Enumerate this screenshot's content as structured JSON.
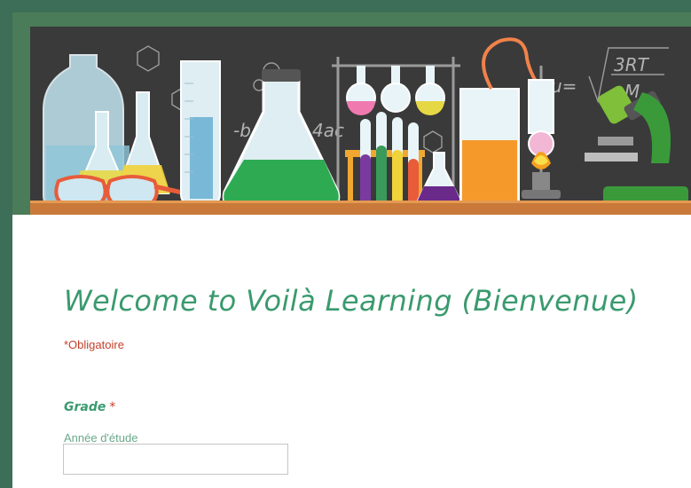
{
  "form": {
    "title": "Welcome to Voilà Learning (Bienvenue)",
    "required_note": "*Obligatoire",
    "questions": [
      {
        "label": "Grade",
        "required_marker": "*",
        "help_text": "Année d'étude",
        "value": "",
        "placeholder": ""
      }
    ]
  },
  "banner": {
    "description_icons": [
      "chemistry-lab-illustration"
    ],
    "chalk_texts": [
      "-b",
      "4ac",
      "u=",
      "3RT",
      "M"
    ]
  },
  "colors": {
    "background": "#3d6e57",
    "accent": "#3a9a6e",
    "required": "#c5402a"
  }
}
